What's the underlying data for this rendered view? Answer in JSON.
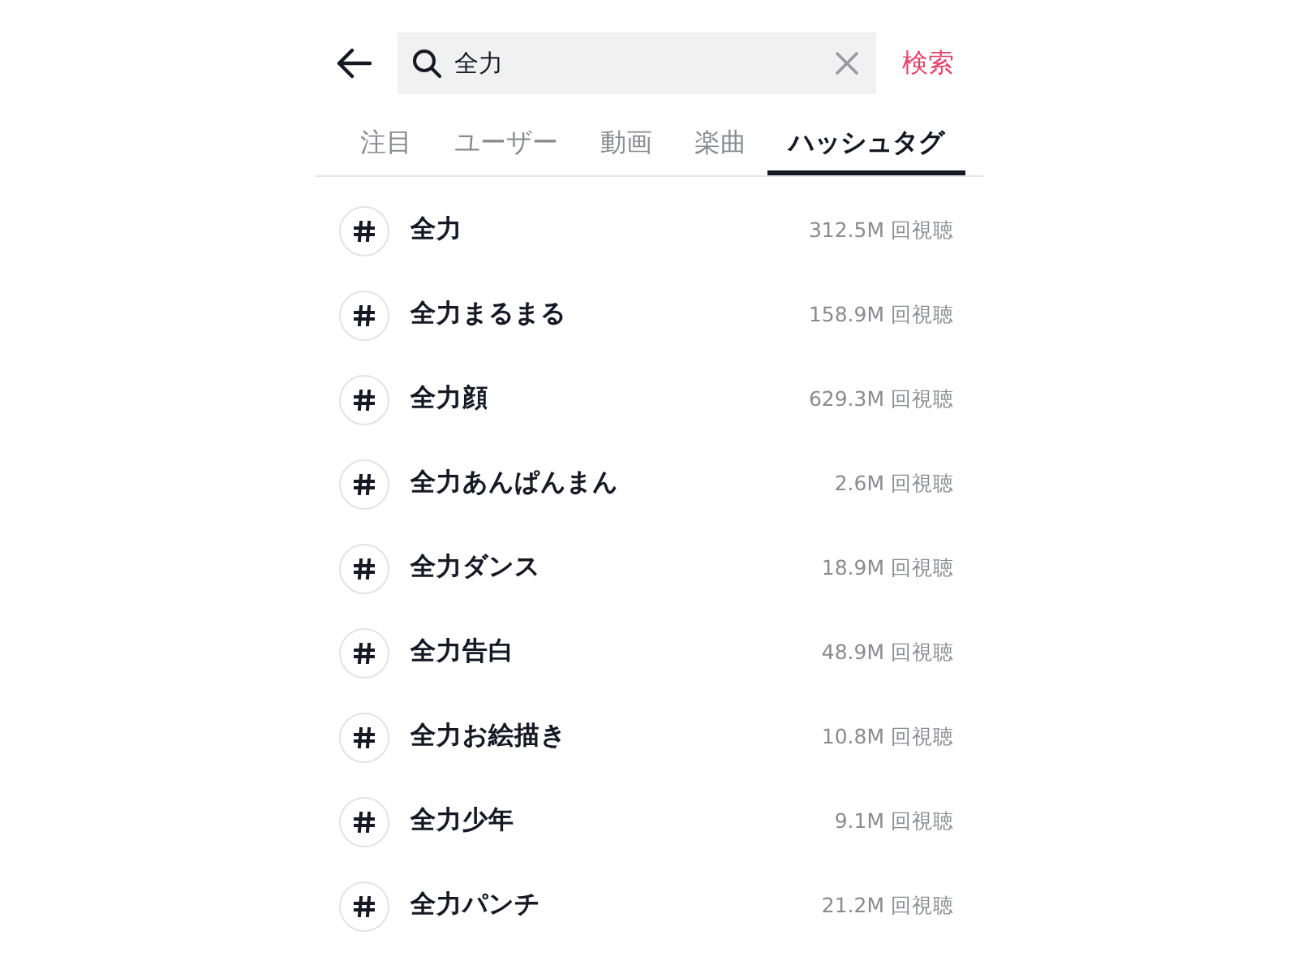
{
  "header": {
    "search": {
      "value": "全力"
    },
    "search_button": "検索"
  },
  "tabs": [
    {
      "label": "注目",
      "selected": false
    },
    {
      "label": "ユーザー",
      "selected": false
    },
    {
      "label": "動画",
      "selected": false
    },
    {
      "label": "楽曲",
      "selected": false
    },
    {
      "label": "ハッシュタグ",
      "selected": true
    }
  ],
  "hashtags": [
    {
      "name": "全力",
      "views": "312.5M 回視聴"
    },
    {
      "name": "全力まるまる",
      "views": "158.9M 回視聴"
    },
    {
      "name": "全力顔",
      "views": "629.3M 回視聴"
    },
    {
      "name": "全力あんぱんまん",
      "views": "2.6M 回視聴"
    },
    {
      "name": "全力ダンス",
      "views": "18.9M 回視聴"
    },
    {
      "name": "全力告白",
      "views": "48.9M 回視聴"
    },
    {
      "name": "全力お絵描き",
      "views": "10.8M 回視聴"
    },
    {
      "name": "全力少年",
      "views": "9.1M 回視聴"
    },
    {
      "name": "全力パンチ",
      "views": "21.2M 回視聴"
    }
  ]
}
